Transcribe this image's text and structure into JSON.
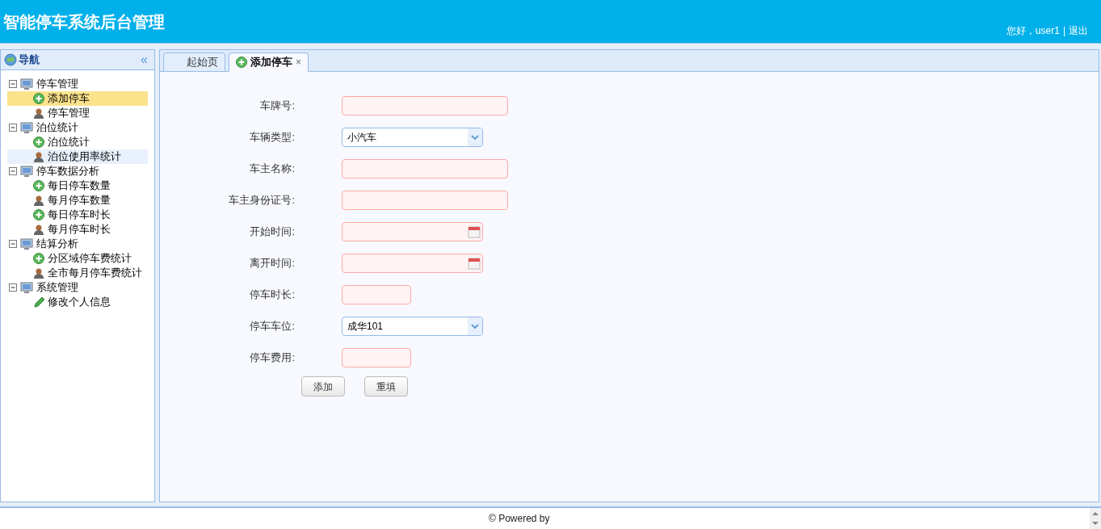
{
  "header": {
    "title": "智能停车系统后台管理",
    "greeting": "您好，user1",
    "separator": "|",
    "logout": "退出"
  },
  "nav": {
    "title": "导航",
    "collapse": "«",
    "groups": [
      {
        "label": "停车管理",
        "expanded": true,
        "children": [
          {
            "label": "添加停车",
            "kind": "add",
            "selected": true,
            "highlighted": false
          },
          {
            "label": "停车管理",
            "kind": "user",
            "selected": false,
            "highlighted": false
          }
        ]
      },
      {
        "label": "泊位统计",
        "expanded": true,
        "children": [
          {
            "label": "泊位统计",
            "kind": "add",
            "selected": false,
            "highlighted": false
          },
          {
            "label": "泊位使用率统计",
            "kind": "user",
            "selected": false,
            "highlighted": true
          }
        ]
      },
      {
        "label": "停车数据分析",
        "expanded": true,
        "children": [
          {
            "label": "每日停车数量",
            "kind": "add",
            "selected": false,
            "highlighted": false
          },
          {
            "label": "每月停车数量",
            "kind": "user",
            "selected": false,
            "highlighted": false
          },
          {
            "label": "每日停车时长",
            "kind": "add",
            "selected": false,
            "highlighted": false
          },
          {
            "label": "每月停车时长",
            "kind": "user",
            "selected": false,
            "highlighted": false
          }
        ]
      },
      {
        "label": "结算分析",
        "expanded": true,
        "children": [
          {
            "label": "分区域停车费统计",
            "kind": "add",
            "selected": false,
            "highlighted": false
          },
          {
            "label": "全市每月停车费统计",
            "kind": "user",
            "selected": false,
            "highlighted": false
          }
        ]
      },
      {
        "label": "系统管理",
        "expanded": true,
        "children": [
          {
            "label": "修改个人信息",
            "kind": "pencil",
            "selected": false,
            "highlighted": false
          }
        ]
      }
    ]
  },
  "tabs": [
    {
      "label": "起始页",
      "selected": false,
      "closable": false,
      "icon": false
    },
    {
      "label": "添加停车",
      "selected": true,
      "closable": true,
      "icon": true,
      "close": "×"
    }
  ],
  "form": {
    "fields": [
      {
        "label": "车牌号:",
        "kind": "text"
      },
      {
        "label": "车辆类型:",
        "kind": "select",
        "value": "小汽车"
      },
      {
        "label": "车主名称:",
        "kind": "text"
      },
      {
        "label": "车主身份证号:",
        "kind": "text"
      },
      {
        "label": "开始时间:",
        "kind": "date"
      },
      {
        "label": "离开时间:",
        "kind": "date"
      },
      {
        "label": "停车时长:",
        "kind": "short"
      },
      {
        "label": "停车车位:",
        "kind": "select",
        "value": "成华101"
      },
      {
        "label": "停车费用:",
        "kind": "short"
      }
    ],
    "buttons": [
      "添加",
      "重填"
    ]
  },
  "footer": {
    "text": "© Powered by"
  }
}
